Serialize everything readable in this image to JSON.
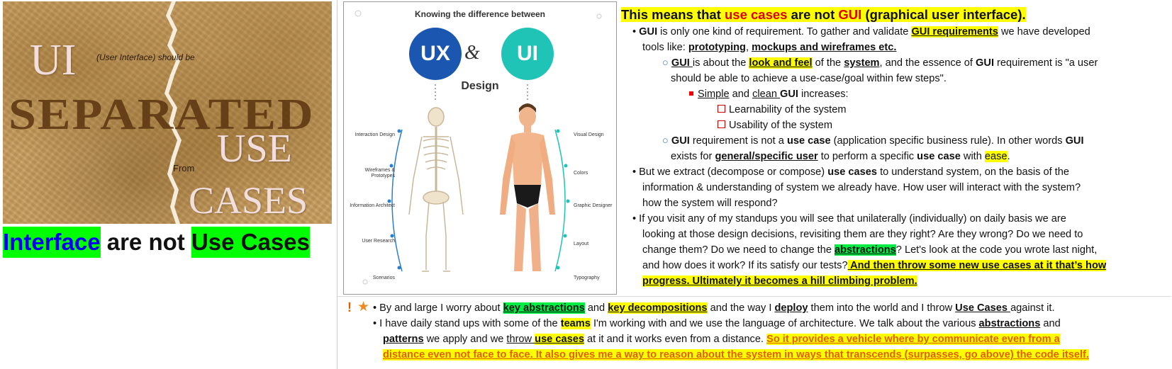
{
  "left_image": {
    "ui_letters": "UI",
    "ui_note": "(User Interface) should be",
    "separated": "SEPARATED",
    "from": "From",
    "use": "USE",
    "cases": "CASES"
  },
  "caption": {
    "part1": "Interface",
    "part2": " are not ",
    "part3": "Use Cases"
  },
  "diagram": {
    "title": "Knowing the difference between",
    "ux": "UX",
    "amp": "&",
    "ui": "UI",
    "design": "Design",
    "left_labels": [
      "Interaction Design",
      "Wireframes & Prototypes",
      "Information Architect",
      "User Research",
      "Scenarios"
    ],
    "right_labels": [
      "Visual Design",
      "Colors",
      "Graphic Designer",
      "Layout",
      "Typography"
    ]
  },
  "colors": {
    "highlight_yellow": "#ffff00",
    "highlight_green": "#00ee44",
    "red_text": "#e00000",
    "ux_blue": "#1b56b0",
    "ui_teal": "#20c4b7"
  },
  "text": {
    "title": [
      "This means that ",
      "use cases",
      " are not ",
      "GUI",
      " (graphical user interface)."
    ],
    "b1": [
      "•",
      " ",
      "GUI",
      " is only one kind of requirement. To gather and validate ",
      "GUI requirements",
      " we have developed"
    ],
    "b1c": [
      "tools like: ",
      "prototyping",
      ", ",
      "mockups and wireframes etc."
    ],
    "b1a": [
      "○",
      " ",
      "GUI ",
      "is about the ",
      "look and feel",
      " of the ",
      "system",
      ", and the essence of ",
      "GUI",
      " requirement is \"a user"
    ],
    "b1ac": "should be able to achieve a use-case/goal within few steps\".",
    "b1a1": [
      "Simple",
      " and ",
      "clean ",
      "GUI",
      " increases:"
    ],
    "b1a1a": "Learnability of the system",
    "b1a1b": "Usability of the system",
    "b1b": [
      "○",
      " ",
      "GUI",
      " requirement is not a ",
      "use case",
      " (application specific business rule). In other words ",
      "GUI"
    ],
    "b1bc": [
      "exists for ",
      "general/specific user",
      " to perform a specific ",
      "use case",
      " with ",
      "ease",
      "."
    ],
    "b2": [
      "•",
      " But we extract (decompose or compose) ",
      "use cases",
      " to understand system, on the basis of the"
    ],
    "b2c1": "information & understanding of system we already have. How user will interact with the system?",
    "b2c2": "how the system will respond?",
    "b3": [
      "•",
      " If you visit any of my standups you will see that unilaterally (individually)  on daily basis we are"
    ],
    "b3c1": "looking at those design decisions, revisiting them are they right? Are they wrong? Do we need to",
    "b3c2": [
      "change them? Do we need to change the ",
      "abstractions",
      "? Let's look at the code you wrote last night,"
    ],
    "b3c3": [
      "and how does it work? If its satisfy our tests?",
      " And then throw some new use cases at it that’s how"
    ],
    "b3c4": "progress. Ultimately it becomes a hill climbing problem."
  },
  "bottom": {
    "marks": [
      "!",
      "★"
    ],
    "l1": [
      "•",
      " By and large I worry about ",
      "key abstractions",
      " and ",
      "key decompositions",
      " and the way I ",
      "deploy",
      " them into the world and I throw ",
      "Use Cases ",
      "against it."
    ],
    "l2": [
      "•",
      " I have daily stand ups with some of the ",
      "teams",
      " I'm working with and we use the language of architecture. We talk about the various ",
      "abstractions",
      " and"
    ],
    "l2c": [
      "patterns",
      " we apply and we ",
      "throw ",
      "use cases",
      " at it and it works even from a distance. ",
      "So it provides a vehicle where by communicate even from a"
    ],
    "l2c2": "distance even not face to face. It also gives me a way to reason about the system in ways that transcends (surpasses, go above) the code itself."
  }
}
